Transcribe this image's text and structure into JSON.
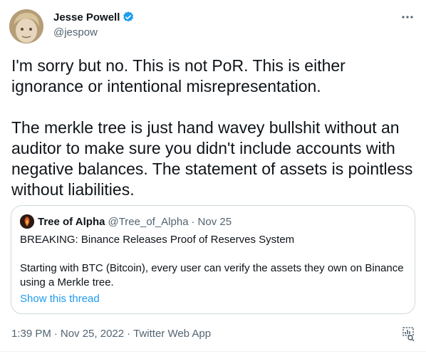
{
  "author": {
    "name": "Jesse Powell",
    "handle": "@jespow"
  },
  "tweet": {
    "paragraphs": [
      "I'm sorry but no. This is not PoR. This is either ignorance or intentional misrepresentation.",
      "The merkle tree is just hand wavey bullshit without an auditor to make sure you didn't include accounts with negative balances. The statement of assets is pointless without liabilities."
    ]
  },
  "quote": {
    "name": "Tree of Alpha",
    "handle": "@Tree_of_Alpha",
    "separator": "·",
    "date": "Nov 25",
    "paragraphs": [
      "BREAKING: Binance Releases Proof of Reserves System",
      "Starting with BTC (Bitcoin), every user can verify the assets they own on Binance using a Merkle tree."
    ],
    "thread_link": "Show this thread"
  },
  "meta": {
    "time": "1:39 PM",
    "date": "Nov 25, 2022",
    "source": "Twitter Web App",
    "separator": "·"
  },
  "colors": {
    "accent": "#1d9bf0",
    "text": "#0f1419",
    "secondary": "#536471",
    "border": "#cfd9de"
  },
  "icons": {
    "verified": "verified-badge-icon",
    "more": "more-horizontal-icon",
    "analytics": "analytics-icon"
  }
}
